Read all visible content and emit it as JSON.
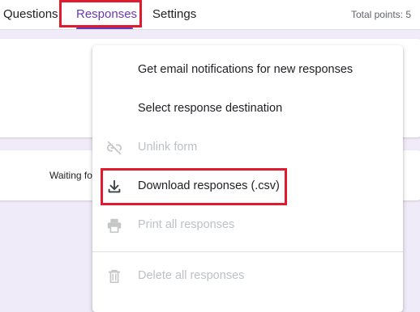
{
  "tabs": {
    "questions": "Questions",
    "responses": "Responses",
    "settings": "Settings"
  },
  "header": {
    "total_points": "Total points: 5"
  },
  "main": {
    "waiting_text": "Waiting fo"
  },
  "menu": {
    "items": [
      {
        "label": "Get email notifications for new responses",
        "enabled": true,
        "icon": null
      },
      {
        "label": "Select response destination",
        "enabled": true,
        "icon": null
      },
      {
        "label": "Unlink form",
        "enabled": false,
        "icon": "link-off-icon"
      },
      {
        "label": "Download responses (.csv)",
        "enabled": true,
        "icon": "download-icon"
      },
      {
        "label": "Print all responses",
        "enabled": false,
        "icon": "print-icon"
      },
      {
        "label": "Delete all responses",
        "enabled": false,
        "icon": "trash-icon"
      }
    ]
  },
  "colors": {
    "accent": "#673ab7",
    "background": "#f0ebf8",
    "highlight": "#e01b2f",
    "disabled": "#bdc1c6"
  }
}
